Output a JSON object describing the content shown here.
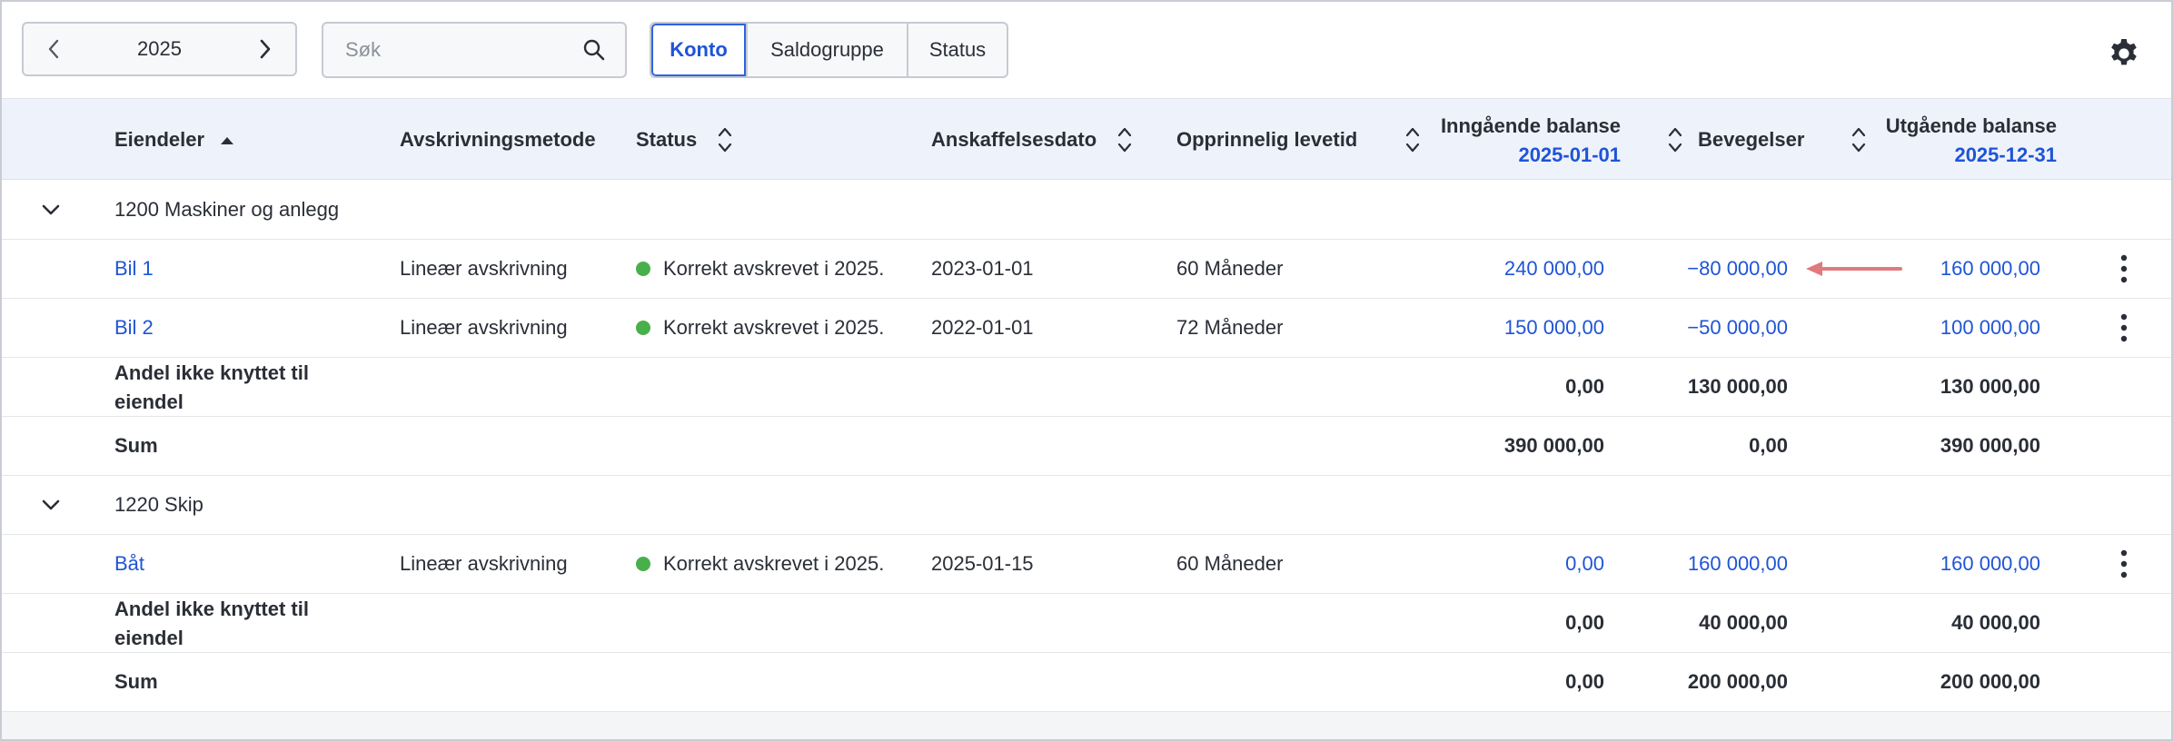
{
  "toolbar": {
    "year": "2025",
    "search_placeholder": "Søk",
    "tabs": [
      "Konto",
      "Saldogruppe",
      "Status"
    ],
    "active_tab": "Konto"
  },
  "columns": {
    "assets": "Eiendeler",
    "method": "Avskrivningsmetode",
    "status": "Status",
    "acquired": "Anskaffelsesdato",
    "lifetime": "Opprinnelig levetid",
    "opening": "Inngående balanse",
    "opening_date": "2025-01-01",
    "movements": "Bevegelser",
    "closing": "Utgående balanse",
    "closing_date": "2025-12-31"
  },
  "groups": [
    {
      "title": "1200 Maskiner og anlegg",
      "rows": [
        {
          "name": "Bil 1",
          "method": "Lineær avskrivning",
          "status": "Korrekt avskrevet i 2025.",
          "acquired": "2023-01-01",
          "lifetime": "60 Måneder",
          "opening": "240 000,00",
          "movements": "−80 000,00",
          "closing": "160 000,00"
        },
        {
          "name": "Bil 2",
          "method": "Lineær avskrivning",
          "status": "Korrekt avskrevet i 2025.",
          "acquired": "2022-01-01",
          "lifetime": "72 Måneder",
          "opening": "150 000,00",
          "movements": "−50 000,00",
          "closing": "100 000,00"
        }
      ],
      "unassigned": {
        "label": "Andel ikke knyttet til eiendel",
        "opening": "0,00",
        "movements": "130 000,00",
        "closing": "130 000,00"
      },
      "sum": {
        "label": "Sum",
        "opening": "390 000,00",
        "movements": "0,00",
        "closing": "390 000,00"
      }
    },
    {
      "title": "1220 Skip",
      "rows": [
        {
          "name": "Båt",
          "method": "Lineær avskrivning",
          "status": "Korrekt avskrevet i 2025.",
          "acquired": "2025-01-15",
          "lifetime": "60 Måneder",
          "opening": "0,00",
          "movements": "160 000,00",
          "closing": "160 000,00"
        }
      ],
      "unassigned": {
        "label": "Andel ikke knyttet til eiendel",
        "opening": "0,00",
        "movements": "40 000,00",
        "closing": "40 000,00"
      },
      "sum": {
        "label": "Sum",
        "opening": "0,00",
        "movements": "200 000,00",
        "closing": "200 000,00"
      }
    }
  ],
  "icons": {
    "prev": "chevron-left-icon",
    "next": "chevron-right-icon",
    "search": "search-icon",
    "settings": "gear-icon",
    "sort": "sort-icon",
    "collapse": "chevron-down-icon",
    "more": "kebab-menu-icon",
    "annotation": "arrow-left-icon"
  },
  "colors": {
    "accent": "#1f54d6",
    "status_ok": "#47b04b",
    "header_bg": "#eef3fb",
    "annotation_arrow": "#e07a7e"
  }
}
